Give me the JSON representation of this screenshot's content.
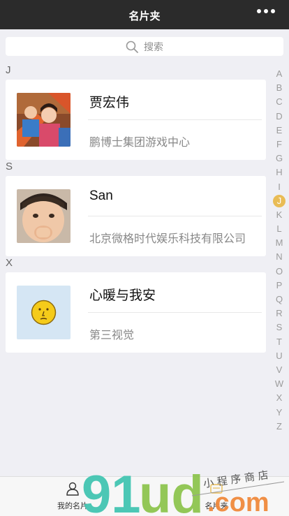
{
  "header": {
    "title": "名片夹",
    "more_icon": "more-dots-icon"
  },
  "search": {
    "placeholder": "搜索",
    "icon": "search-icon"
  },
  "groups": [
    {
      "letter": "J",
      "card": {
        "name": "贾宏伟",
        "company": "鹏博士集团游戏中心",
        "avatar": "photo-kids"
      }
    },
    {
      "letter": "S",
      "card": {
        "name": "San",
        "company": "北京微格时代娱乐科技有限公司",
        "avatar": "photo-child"
      }
    },
    {
      "letter": "X",
      "card": {
        "name": "心暖与我安",
        "company": "第三视觉",
        "avatar": "smiley-face"
      }
    }
  ],
  "index": {
    "letters": [
      "A",
      "B",
      "C",
      "D",
      "E",
      "F",
      "G",
      "H",
      "I",
      "J",
      "K",
      "L",
      "M",
      "N",
      "O",
      "P",
      "Q",
      "R",
      "S",
      "T",
      "U",
      "V",
      "W",
      "X",
      "Y",
      "Z"
    ],
    "active": "J",
    "active_color": "#e9bc55"
  },
  "tabbar": {
    "tabs": [
      {
        "label": "我的名片",
        "icon": "person-icon"
      },
      {
        "label": "名片夹",
        "icon": "cards-icon"
      }
    ]
  },
  "watermark": {
    "brand": "91ud",
    "suffix": ".com",
    "tagline": "小程序商店"
  }
}
